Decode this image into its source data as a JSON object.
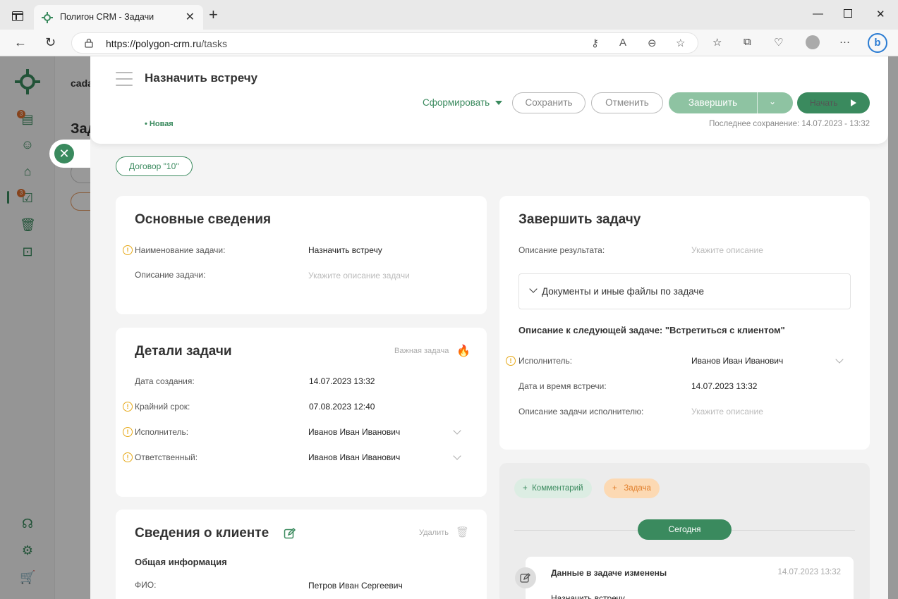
{
  "browser": {
    "tab_title": "Полигон CRM - Задачи",
    "url_host": "https://polygon-crm.ru",
    "url_path": "/tasks"
  },
  "background": {
    "header_text": "cada",
    "page_title_fragment": "Зад",
    "sidebar_badges": [
      "3",
      "3"
    ]
  },
  "panel": {
    "title": "Назначить встречу",
    "status": "• Новая",
    "actions": {
      "form": "Сформировать",
      "save": "Сохранить",
      "cancel": "Отменить",
      "finish": "Завершить",
      "start": "Начать"
    },
    "last_save": "Последнее сохранение: 14.07.2023 - 13:32",
    "contract": "Договор \"10\""
  },
  "basic": {
    "title": "Основные сведения",
    "name_label": "Наименование задачи:",
    "name_value": "Назначить встречу",
    "desc_label": "Описание задачи:",
    "desc_placeholder": "Укажите описание задачи"
  },
  "details": {
    "title": "Детали задачи",
    "important": "Важная задача",
    "created_label": "Дата создания:",
    "created_value": "14.07.2023 13:32",
    "deadline_label": "Крайний срок:",
    "deadline_value": "07.08.2023 12:40",
    "executor_label": "Исполнитель:",
    "executor_value": "Иванов Иван Иванович",
    "responsible_label": "Ответственный:",
    "responsible_value": "Иванов Иван Иванович"
  },
  "client": {
    "title": "Сведения о клиенте",
    "delete": "Удалить",
    "section": "Общая информация",
    "fio_label": "ФИО:",
    "fio_value": "Петров Иван Сергеевич"
  },
  "complete": {
    "title": "Завершить задачу",
    "result_label": "Описание результата:",
    "result_placeholder": "Укажите описание",
    "docs": "Документы и иные файлы по задаче",
    "next_title": "Описание к следующей задаче: \"Встретиться с клиентом\"",
    "executor_label": "Исполнитель:",
    "executor_value": "Иванов Иван Иванович",
    "meeting_label": "Дата и время встречи:",
    "meeting_value": "14.07.2023 13:32",
    "exec_desc_label": "Описание задачи исполнителю:",
    "exec_desc_placeholder": "Укажите описание"
  },
  "timeline": {
    "comment_btn": "Комментарий",
    "task_btn": "Задача",
    "today": "Сегодня",
    "event_title": "Данные в задаче изменены",
    "event_time": "14.07.2023 13:32",
    "event_text": "Назначить встречу"
  }
}
